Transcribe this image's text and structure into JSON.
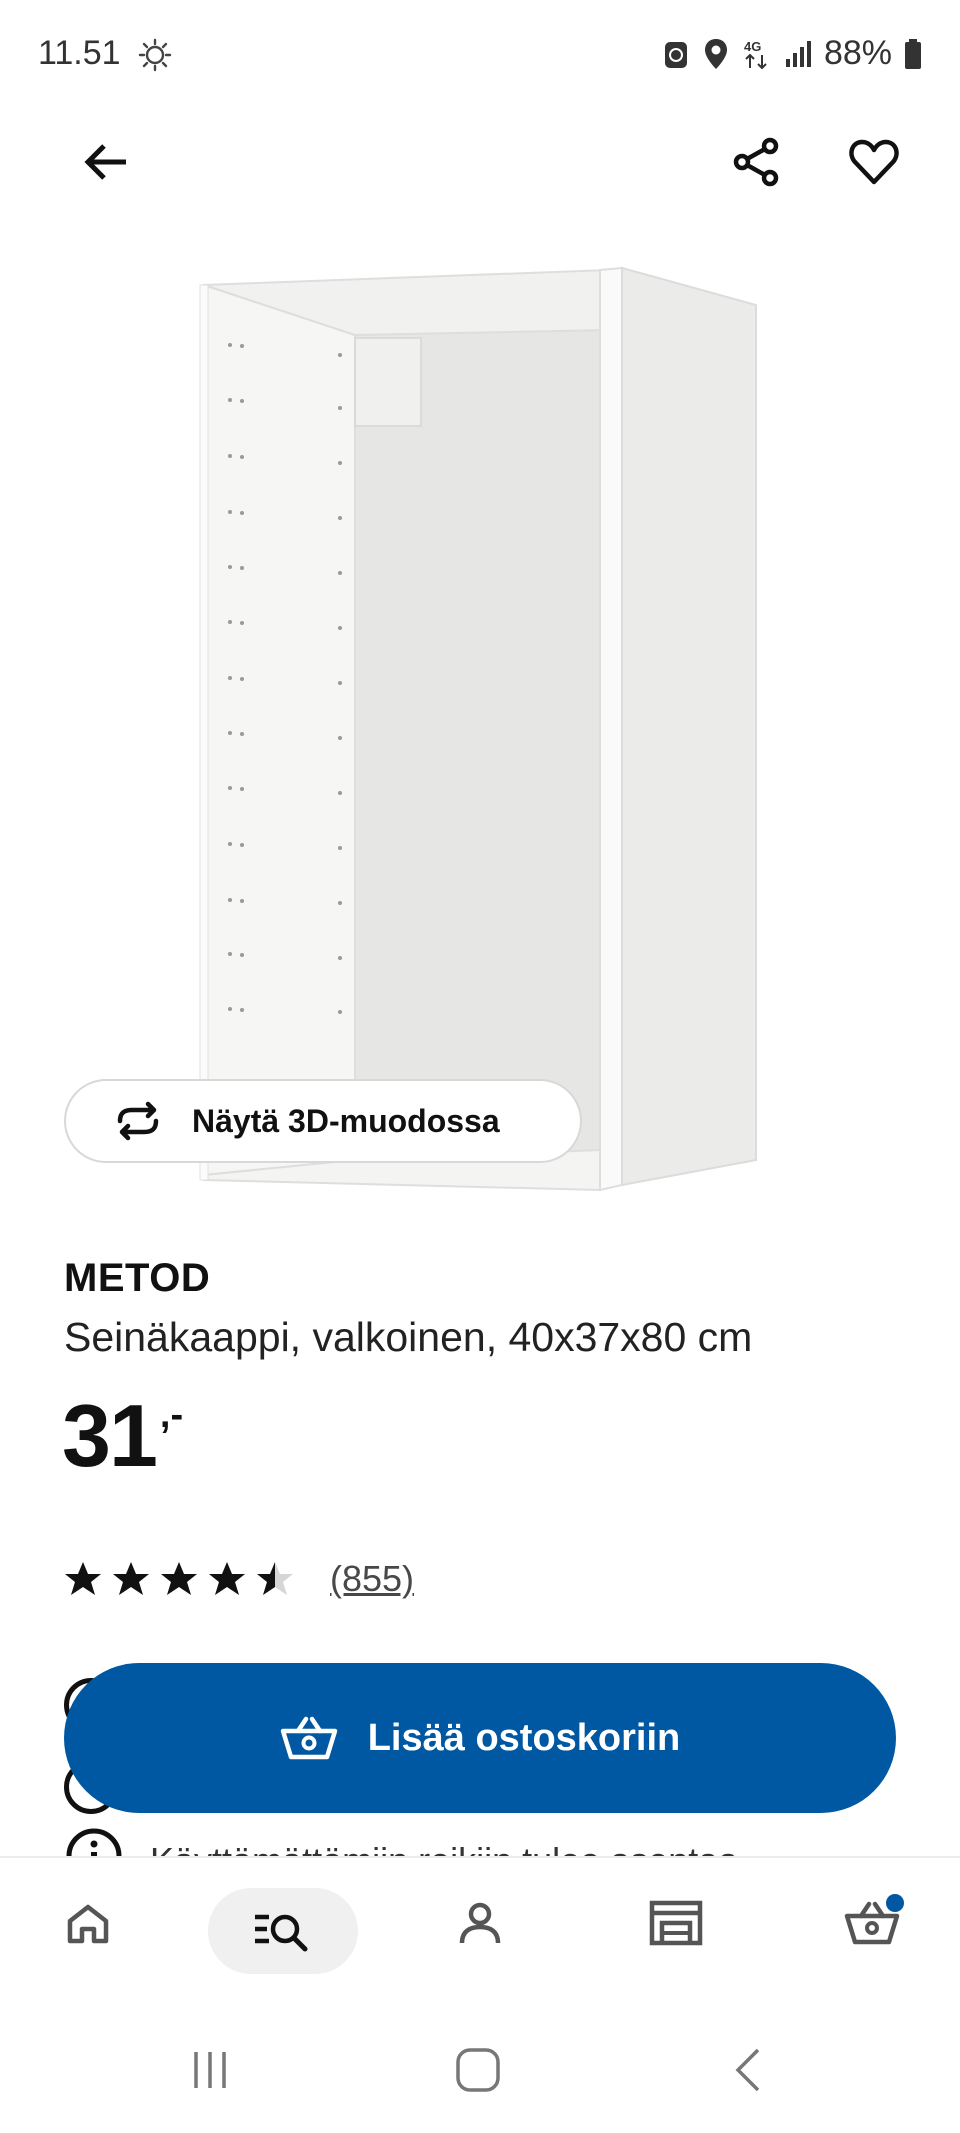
{
  "status_bar": {
    "time": "11.51",
    "network": "4G",
    "battery": "88%"
  },
  "header": {
    "back_icon": "arrow-left-icon",
    "share_icon": "share-icon",
    "favorite_icon": "heart-icon"
  },
  "product": {
    "view_3d_label": "Näytä 3D-muodossa",
    "name": "METOD",
    "description": "Seinäkaappi, valkoinen, 40x37x80 cm",
    "price_integer": "31",
    "price_suffix": ",-",
    "rating_value": 4.5,
    "rating_max": 5,
    "review_count": "(855)",
    "info_partial_text": "Käyttämättömiin reikiin tulee asentaa"
  },
  "cart_button": {
    "label": "Lisää ostoskoriin",
    "icon": "basket-icon"
  },
  "bottom_nav": {
    "items": [
      "home-icon",
      "search-list-icon",
      "profile-icon",
      "store-icon",
      "basket-icon"
    ],
    "active": "search-list-icon",
    "accent": "#0058a3"
  },
  "colors": {
    "primary": "#0058a3",
    "text": "#111111"
  }
}
